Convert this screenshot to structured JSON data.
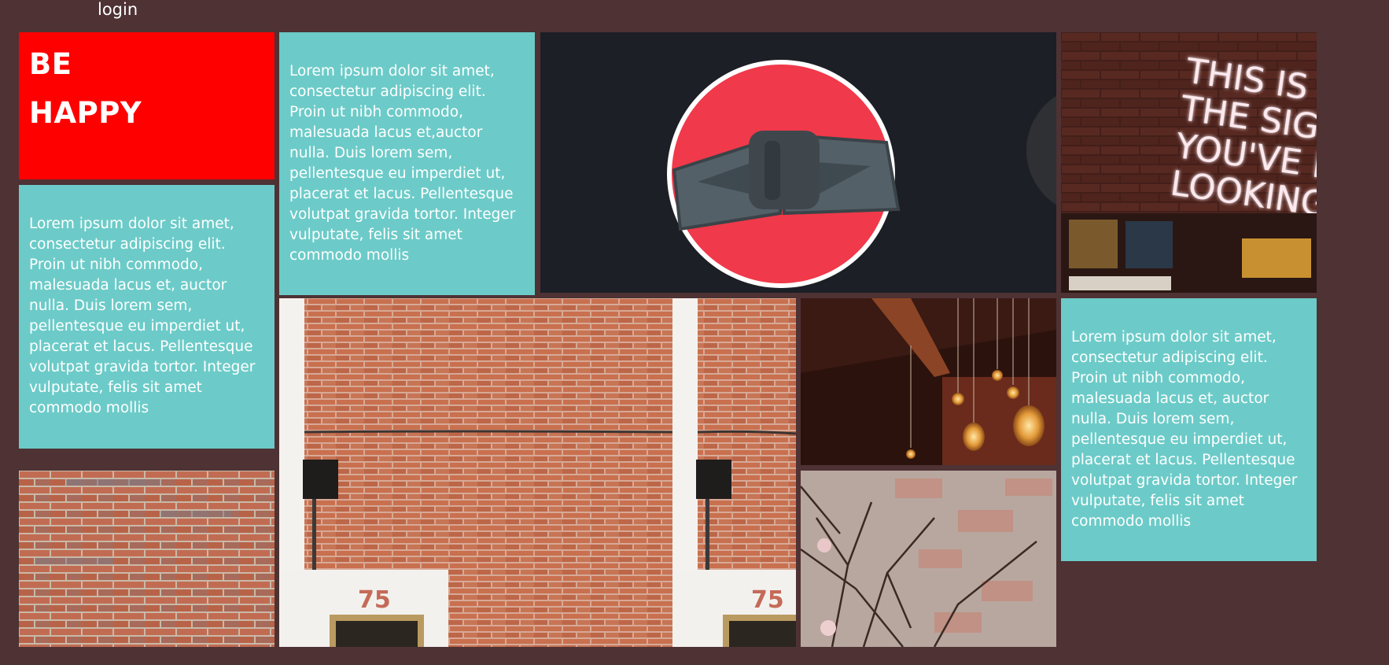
{
  "nav": {
    "login_label": "login"
  },
  "hero": {
    "line1": "BE",
    "line2": "HAPPY",
    "background": "#ff0000"
  },
  "text_tiles": [
    {
      "text": "Lorem ipsum dolor sit amet, consectetur adipiscing elit. Proin ut nibh commodo, malesuada lacus et, auctor nulla. Duis lorem sem, pellentesque eu imperdiet ut, placerat et lacus. Pellentesque volutpat gravida tortor. Integer vulputate, felis sit amet commodo mollis"
    },
    {
      "text": "Lorem ipsum dolor sit amet, consectetur adipiscing elit. Proin ut nibh commodo, malesuada lacus et,auctor nulla. Duis lorem sem, pellentesque eu imperdiet ut, placerat et lacus. Pellentesque volutpat gravida tortor. Integer vulputate, felis sit amet commodo mollis"
    },
    {
      "text": "Lorem ipsum dolor sit amet, consectetur adipiscing elit. Proin ut nibh commodo, malesuada lacus et, auctor nulla. Duis lorem sem, pellentesque eu imperdiet ut, placerat et lacus. Pellentesque volutpat gravida tortor. Integer vulputate, felis sit amet commodo mollis"
    }
  ],
  "images": {
    "bowtie_logo": "bowtie-logo-icon",
    "neon_sign": {
      "lines": [
        "THIS IS",
        "THE SIGN",
        "YOU'VE BEEN",
        "LOOKING FO"
      ]
    },
    "building_number": "75"
  },
  "colors": {
    "page_background": "#4e3234",
    "text_tile": "#6ccbc8",
    "logo_circle": "#f0394a",
    "bowtie": "#546068"
  }
}
